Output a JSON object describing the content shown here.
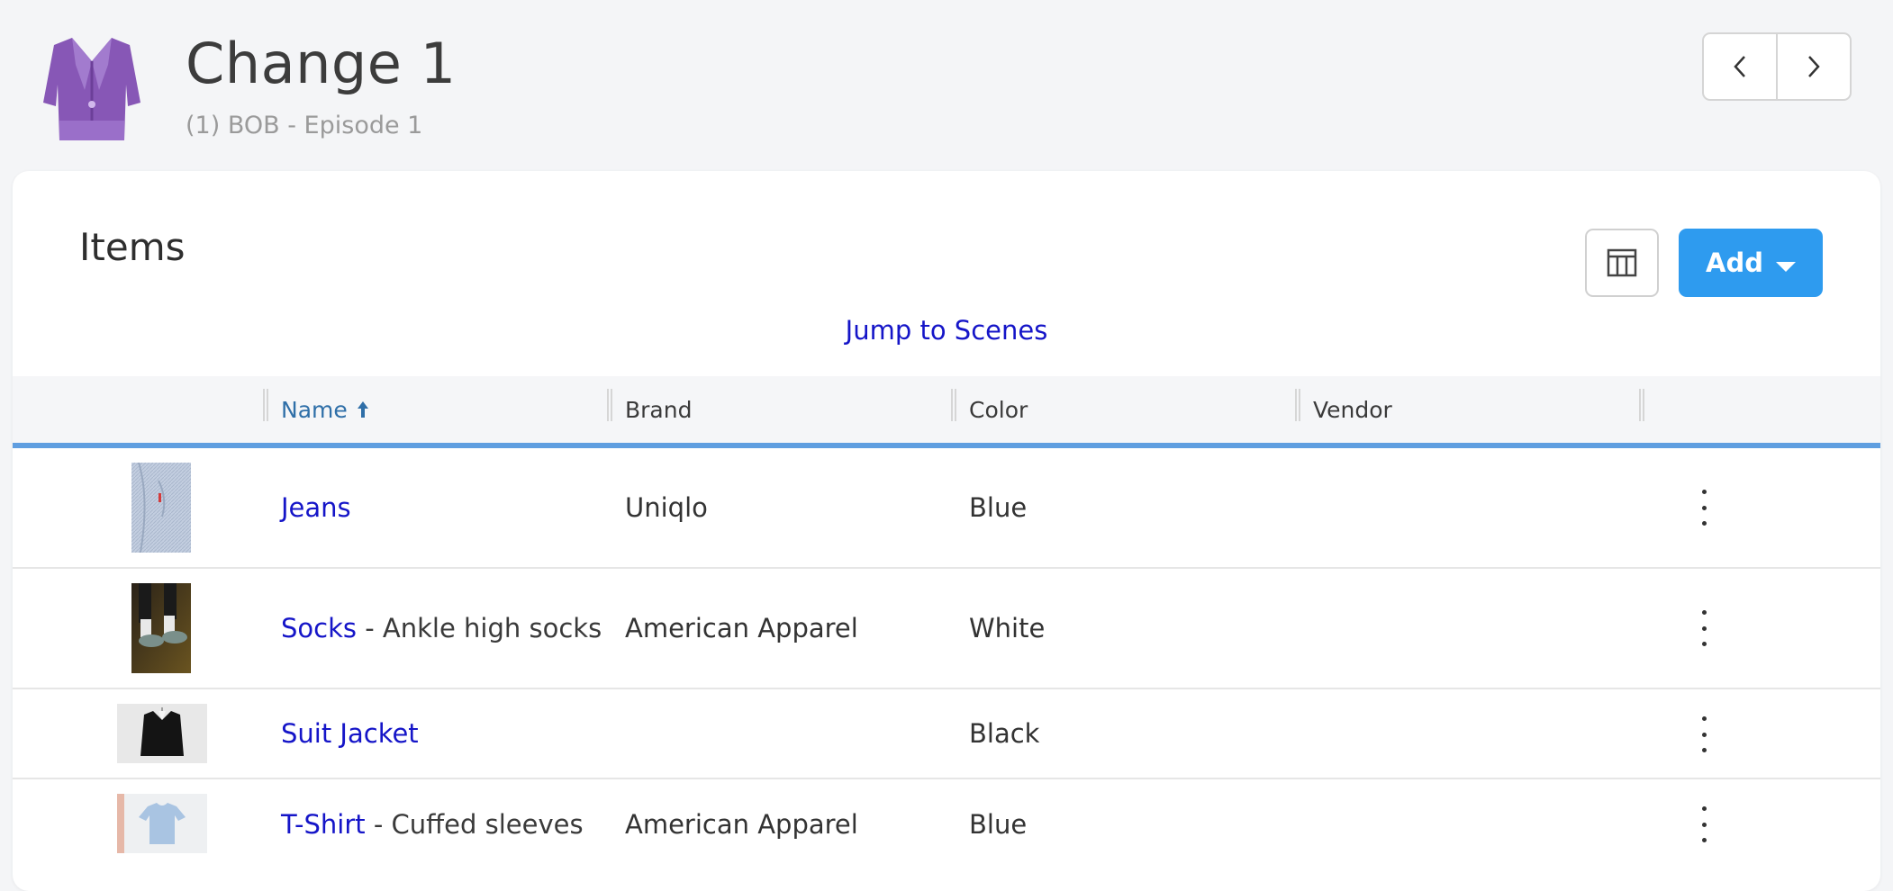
{
  "header": {
    "title": "Change 1",
    "subtitle": "(1) BOB - Episode 1",
    "logo_icon": "jacket-icon",
    "prev_icon": "chevron-left-icon",
    "next_icon": "chevron-right-icon"
  },
  "card": {
    "title": "Items",
    "jump_link": "Jump to Scenes",
    "add_label": "Add",
    "columns_icon": "columns-icon"
  },
  "table": {
    "columns": [
      "Name",
      "Brand",
      "Color",
      "Vendor"
    ],
    "sort_column": "Name",
    "sort_direction": "ascending",
    "rows": [
      {
        "name": "Jeans",
        "desc": "",
        "brand": "Uniqlo",
        "color": "Blue",
        "vendor": ""
      },
      {
        "name": "Socks",
        "desc": " - Ankle high socks",
        "brand": "American Apparel",
        "color": "White",
        "vendor": ""
      },
      {
        "name": "Suit Jacket",
        "desc": "",
        "brand": "",
        "color": "Black",
        "vendor": ""
      },
      {
        "name": "T-Shirt",
        "desc": " - Cuffed sleeves",
        "brand": "American Apparel",
        "color": "Blue",
        "vendor": ""
      }
    ]
  },
  "colors": {
    "accent": "#2e9bef",
    "link": "#1515c8",
    "header_border": "#5f9ee0",
    "logo": "#8a5ab8"
  }
}
